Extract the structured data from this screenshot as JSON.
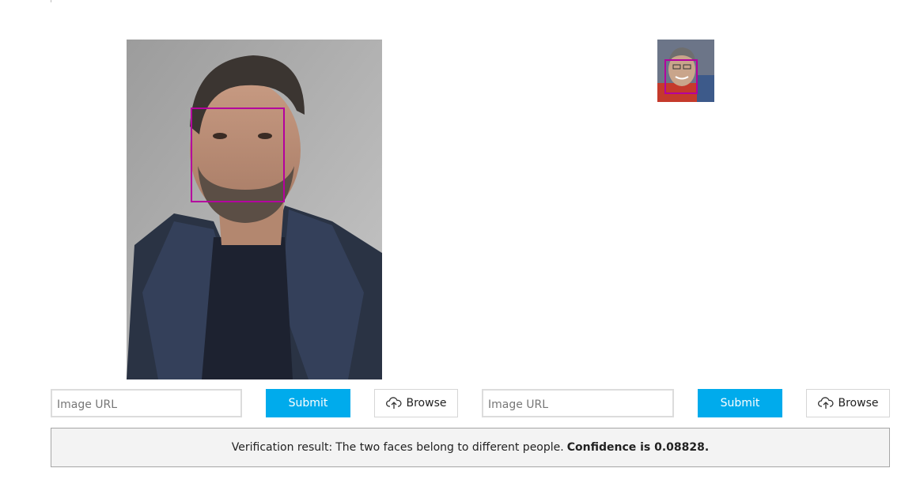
{
  "left_panel": {
    "url_placeholder": "Image URL",
    "submit_label": "Submit",
    "browse_label": "Browse"
  },
  "right_panel": {
    "url_placeholder": "Image URL",
    "submit_label": "Submit",
    "browse_label": "Browse"
  },
  "result": {
    "prefix": "Verification result:",
    "message": "The two faces belong to different people.",
    "confidence_text": "Confidence is 0.08828."
  },
  "colors": {
    "accent": "#00abec",
    "face_box": "#b4009e",
    "result_background": "#f3f3f3"
  },
  "icons": {
    "browse": "cloud-upload-icon"
  }
}
